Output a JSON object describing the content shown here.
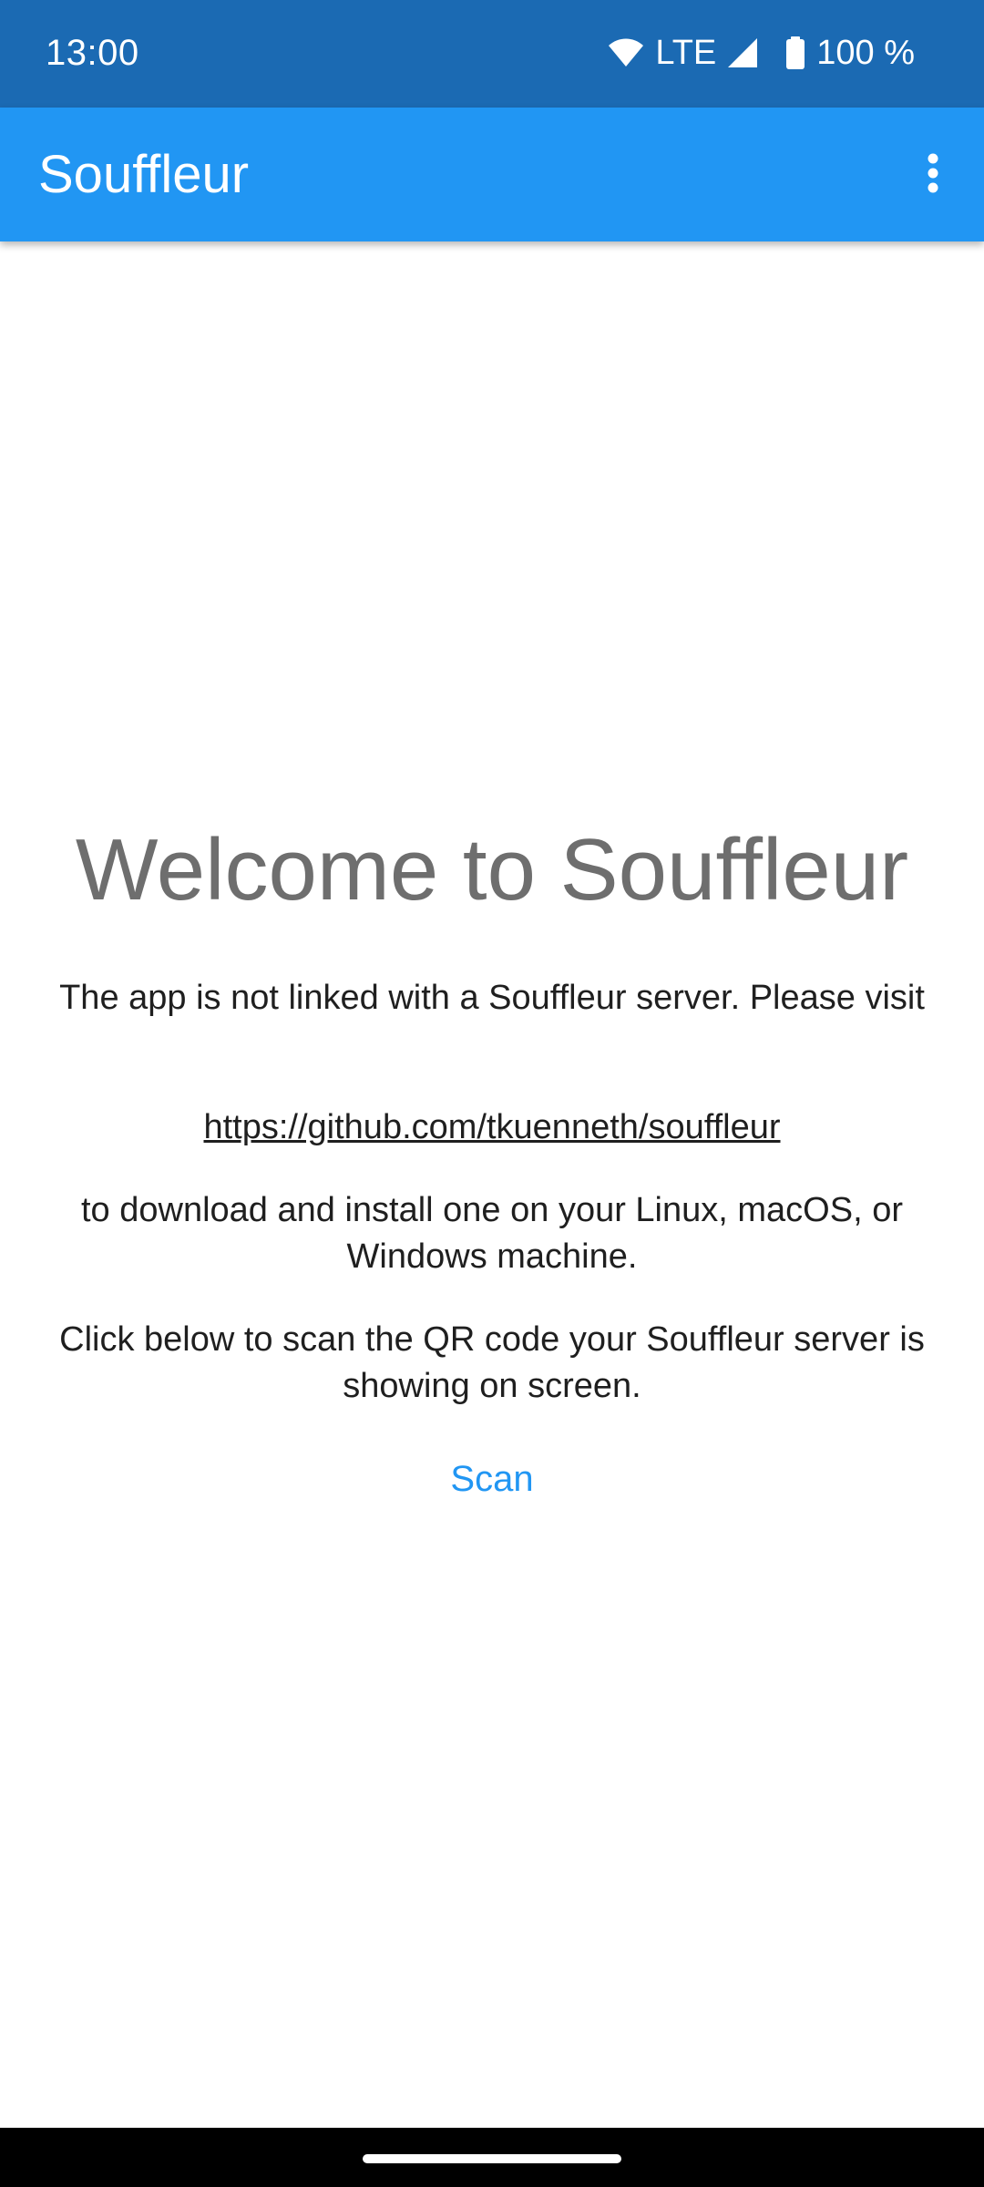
{
  "status_bar": {
    "time": "13:00",
    "network": "LTE",
    "battery": "100 %",
    "icons": [
      "wifi-icon",
      "signal-icon",
      "battery-icon"
    ],
    "background_color": "#1b6ab3"
  },
  "app_bar": {
    "title": "Souffleur",
    "overflow_icon": "more-vert-icon",
    "background_color": "#2196f3"
  },
  "main": {
    "welcome_title": "Welcome to Souffleur",
    "intro_text": "The app is not linked with a Souffleur server. Please visit",
    "link_text": "https://github.com/tkuenneth/souffleur",
    "download_text": "to download and install one on your Linux, macOS, or Windows machine.",
    "scan_instruction": "Click below to scan the QR code your Souffleur server is showing on screen.",
    "scan_button_label": "Scan",
    "accent_color": "#2196f3"
  }
}
